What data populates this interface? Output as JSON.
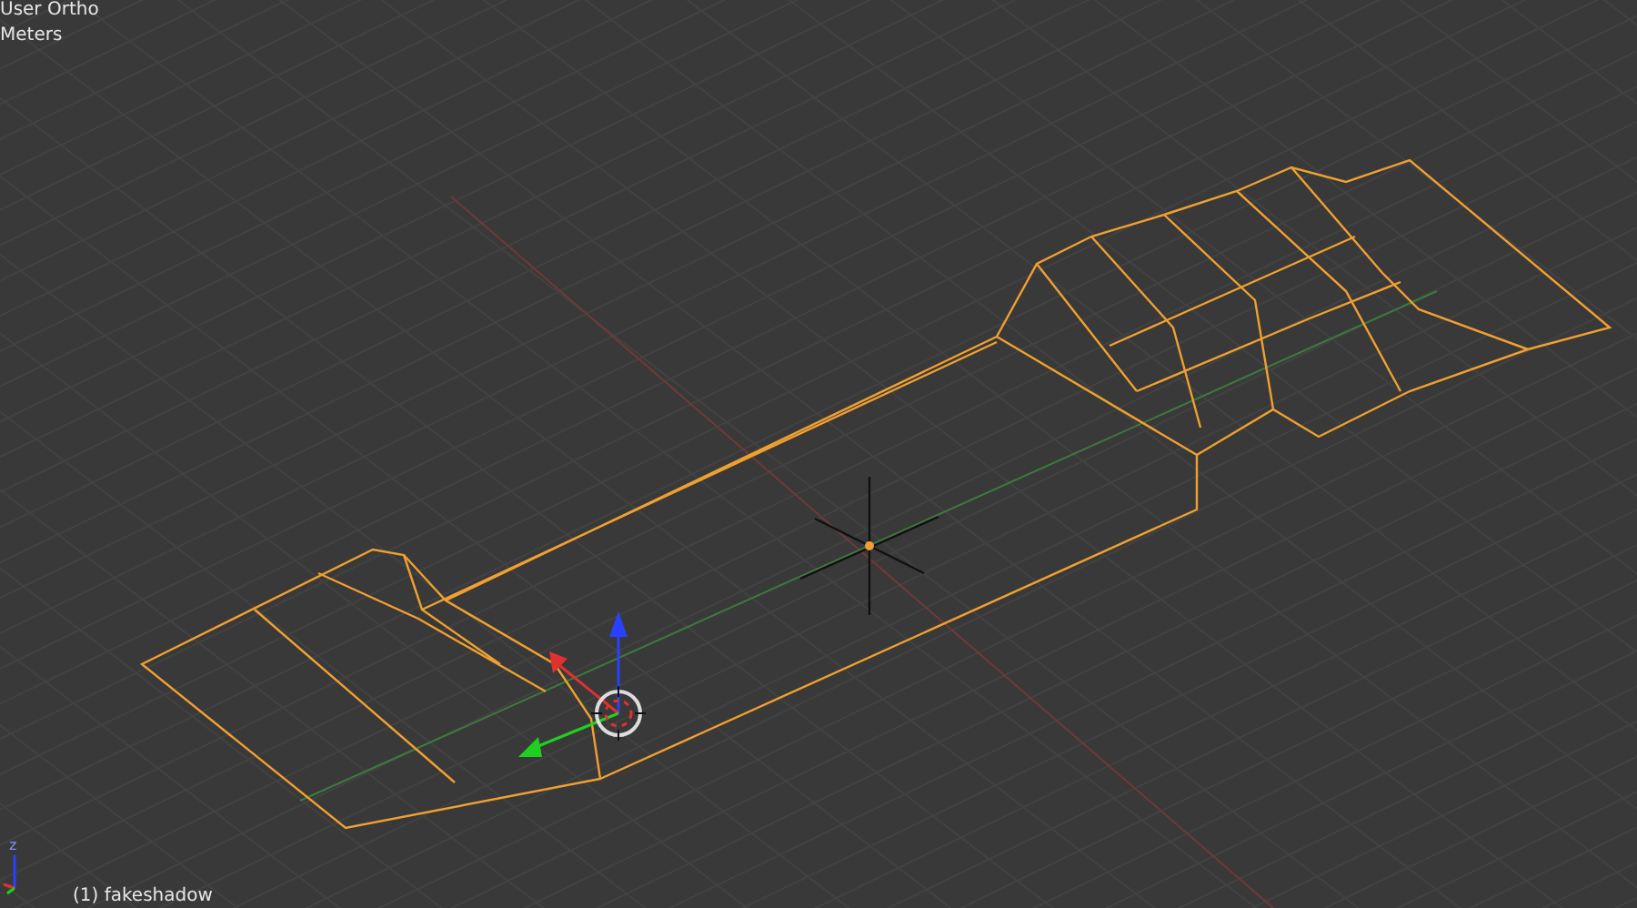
{
  "viewport": {
    "view_name": "User Ortho",
    "units": "Meters",
    "object_label": "(1) fakeshadow",
    "axis_label": "z"
  }
}
